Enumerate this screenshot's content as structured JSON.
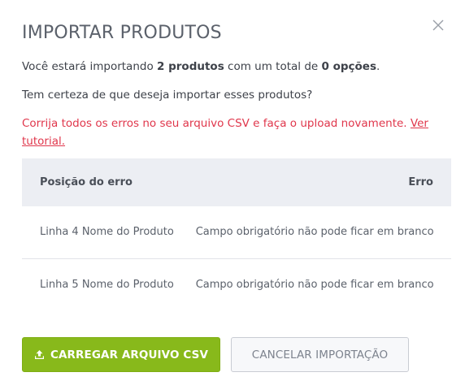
{
  "modal": {
    "title": "IMPORTAR PRODUTOS",
    "close_icon": "close-icon",
    "summary": {
      "prefix": "Você estará importando ",
      "count": "2 produtos",
      "middle": " com um total de ",
      "options": "0 opções",
      "suffix": "."
    },
    "confirm_text": "Tem certeza de que deseja importar esses produtos?",
    "error_message": "Corrija todos os erros no seu arquivo CSV e faça o upload novamente. ",
    "error_link": "Ver tutorial.",
    "error_color": "#e0364b"
  },
  "table": {
    "headers": [
      "Posição do erro",
      "Erro"
    ],
    "rows": [
      [
        "Linha 4 Nome do Produto",
        "Campo obrigatório não pode ficar em branco"
      ],
      [
        "Linha 5 Nome do Produto",
        "Campo obrigatório não pode ficar em branco"
      ]
    ]
  },
  "actions": {
    "upload_label": "CARREGAR ARQUIVO CSV",
    "upload_icon": "upload-icon",
    "upload_color": "#88b91b",
    "cancel_label": "CANCELAR IMPORTAÇÃO"
  }
}
